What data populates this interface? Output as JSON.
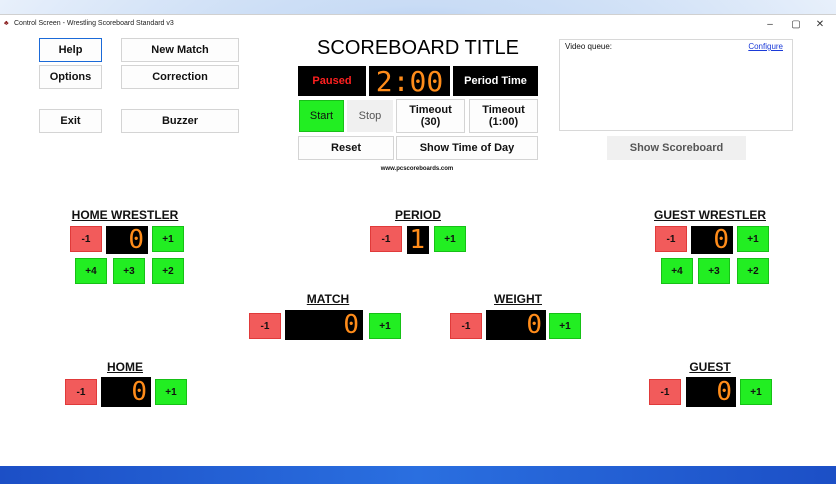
{
  "window": {
    "title": "Control Screen - Wrestling Scoreboard Standard v3",
    "minimize": "–",
    "maximize": "▢",
    "close": "✕"
  },
  "buttons": {
    "help": "Help",
    "new_match": "New Match",
    "options": "Options",
    "correction": "Correction",
    "exit": "Exit",
    "buzzer": "Buzzer",
    "start": "Start",
    "stop": "Stop",
    "timeout30_line1": "Timeout",
    "timeout30_line2": "(30)",
    "timeout100_line1": "Timeout",
    "timeout100_line2": "(1:00)",
    "reset": "Reset",
    "show_time_of_day": "Show Time of Day",
    "show_scoreboard": "Show Scoreboard",
    "period_time": "Period Time"
  },
  "scoreboard": {
    "title": "SCOREBOARD TITLE",
    "status": "Paused",
    "clock": "2:00",
    "website": "www.pcscoreboards.com"
  },
  "video_queue": {
    "label": "Video queue:",
    "configure": "Configure"
  },
  "home_wrestler": {
    "title": "HOME WRESTLER",
    "score": "0",
    "minus": "-1",
    "plus1": "+1",
    "plus4": "+4",
    "plus3": "+3",
    "plus2": "+2"
  },
  "guest_wrestler": {
    "title": "GUEST WRESTLER",
    "score": "0",
    "minus": "-1",
    "plus1": "+1",
    "plus4": "+4",
    "plus3": "+3",
    "plus2": "+2"
  },
  "period": {
    "title": "PERIOD",
    "value": "1",
    "minus": "-1",
    "plus": "+1"
  },
  "match": {
    "title": "MATCH",
    "value": "0",
    "minus": "-1",
    "plus": "+1"
  },
  "weight": {
    "title": "WEIGHT",
    "value": "0",
    "minus": "-1",
    "plus": "+1"
  },
  "home": {
    "title": "HOME",
    "value": "0",
    "minus": "-1",
    "plus": "+1"
  },
  "guest": {
    "title": "GUEST",
    "value": "0",
    "minus": "-1",
    "plus": "+1"
  },
  "colors": {
    "accent_green": "#22ee22",
    "minus_red": "#f25b5b",
    "display_digit": "#ff8c1a",
    "paused_red": "#ff2020"
  }
}
